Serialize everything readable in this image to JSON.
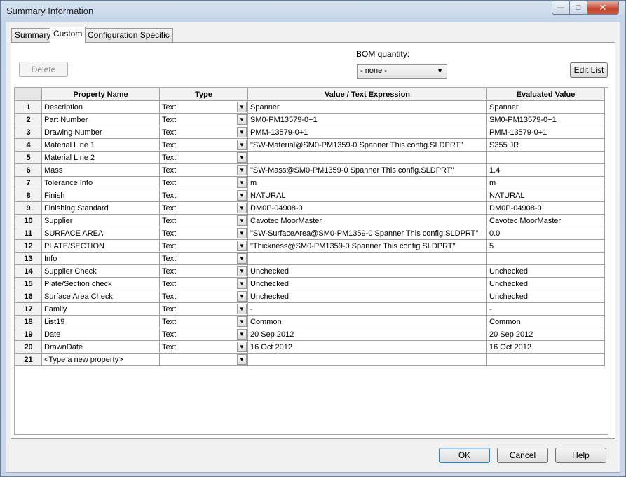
{
  "window": {
    "title": "Summary Information"
  },
  "titlebar_buttons": {
    "minimize": "—",
    "maximize": "□",
    "close": "✕"
  },
  "tabs": [
    {
      "label": "Summary"
    },
    {
      "label": "Custom"
    },
    {
      "label": "Configuration Specific"
    }
  ],
  "active_tab": "Custom",
  "toolbar": {
    "delete_label": "Delete",
    "bom_label": "BOM quantity:",
    "bom_value": "- none -",
    "edit_list_label": "Edit List"
  },
  "grid": {
    "columns": [
      "Property Name",
      "Type",
      "Value / Text Expression",
      "Evaluated Value"
    ],
    "rows": [
      {
        "num": "1",
        "name": "Description",
        "type": "Text",
        "value": "Spanner",
        "evaluated": "Spanner"
      },
      {
        "num": "2",
        "name": "Part Number",
        "type": "Text",
        "value": "SM0-PM13579-0+1",
        "evaluated": "SM0-PM13579-0+1"
      },
      {
        "num": "3",
        "name": "Drawing Number",
        "type": "Text",
        "value": "PMM-13579-0+1",
        "evaluated": "PMM-13579-0+1"
      },
      {
        "num": "4",
        "name": "Material Line 1",
        "type": "Text",
        "value": "\"SW-Material@SM0-PM1359-0 Spanner This config.SLDPRT\"",
        "evaluated": "S355 JR"
      },
      {
        "num": "5",
        "name": "Material Line 2",
        "type": "Text",
        "value": "",
        "evaluated": ""
      },
      {
        "num": "6",
        "name": "Mass",
        "type": "Text",
        "value": "\"SW-Mass@SM0-PM1359-0 Spanner This config.SLDPRT\"",
        "evaluated": "1.4"
      },
      {
        "num": "7",
        "name": "Tolerance Info",
        "type": "Text",
        "value": "m",
        "evaluated": "m"
      },
      {
        "num": "8",
        "name": "Finish",
        "type": "Text",
        "value": "NATURAL",
        "evaluated": "NATURAL"
      },
      {
        "num": "9",
        "name": "Finishing Standard",
        "type": "Text",
        "value": "DM0P-04908-0",
        "evaluated": "DM0P-04908-0"
      },
      {
        "num": "10",
        "name": "Supplier",
        "type": "Text",
        "value": "Cavotec MoorMaster",
        "evaluated": "Cavotec MoorMaster"
      },
      {
        "num": "11",
        "name": "SURFACE AREA",
        "type": "Text",
        "value": "\"SW-SurfaceArea@SM0-PM1359-0 Spanner This config.SLDPRT\"",
        "evaluated": "0.0"
      },
      {
        "num": "12",
        "name": "PLATE/SECTION",
        "type": "Text",
        "value": "\"Thickness@SM0-PM1359-0 Spanner This config.SLDPRT\"",
        "evaluated": "5"
      },
      {
        "num": "13",
        "name": "Info",
        "type": "Text",
        "value": "",
        "evaluated": ""
      },
      {
        "num": "14",
        "name": "Supplier Check",
        "type": "Text",
        "value": "Unchecked",
        "evaluated": "Unchecked"
      },
      {
        "num": "15",
        "name": "Plate/Section check",
        "type": "Text",
        "value": "Unchecked",
        "evaluated": "Unchecked"
      },
      {
        "num": "16",
        "name": "Surface Area Check",
        "type": "Text",
        "value": "Unchecked",
        "evaluated": "Unchecked"
      },
      {
        "num": "17",
        "name": "Family",
        "type": "Text",
        "value": "-",
        "evaluated": "-"
      },
      {
        "num": "18",
        "name": "List19",
        "type": "Text",
        "value": "Common",
        "evaluated": "Common"
      },
      {
        "num": "19",
        "name": "Date",
        "type": "Text",
        "value": "20 Sep 2012",
        "evaluated": "20 Sep 2012"
      },
      {
        "num": "20",
        "name": "DrawnDate",
        "type": "Text",
        "value": "16 Oct 2012",
        "evaluated": "16 Oct 2012"
      },
      {
        "num": "21",
        "name": "<Type a new property>",
        "type": "",
        "value": "",
        "evaluated": ""
      }
    ]
  },
  "footer": {
    "ok_label": "OK",
    "cancel_label": "Cancel",
    "help_label": "Help"
  }
}
